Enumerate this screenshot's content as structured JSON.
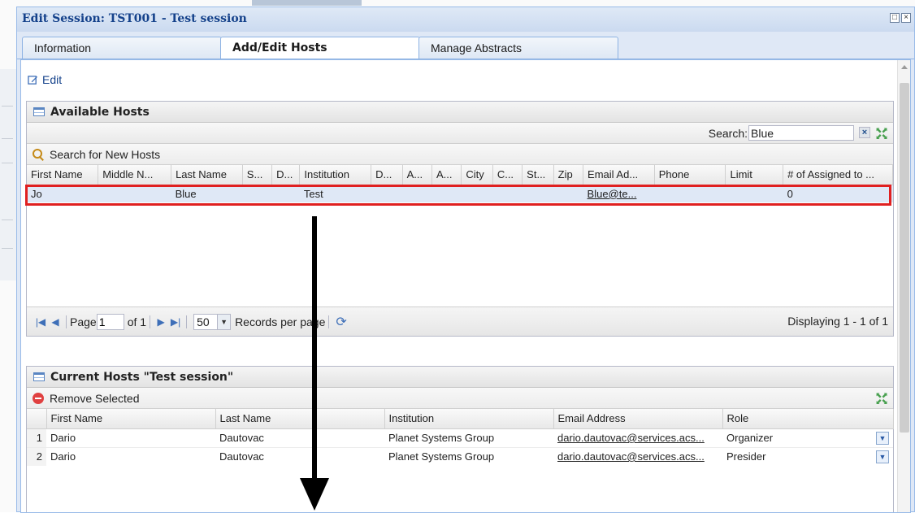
{
  "window": {
    "title": "Edit Session: TST001 - Test session"
  },
  "tabs": [
    {
      "label": "Information"
    },
    {
      "label": "Add/Edit Hosts"
    },
    {
      "label": "Manage Abstracts"
    }
  ],
  "edit_link": "Edit",
  "available_hosts": {
    "title": "Available Hosts",
    "search_label": "Search:",
    "search_value": "Blue",
    "action_label": "Search for New Hosts",
    "columns": [
      "First Name",
      "Middle N...",
      "Last Name",
      "S...",
      "D...",
      "Institution",
      "D...",
      "A...",
      "A...",
      "City",
      "C...",
      "St...",
      "Zip",
      "Email Ad...",
      "Phone",
      "Limit",
      "# of Assigned to ..."
    ],
    "rows": [
      [
        "Jo",
        "",
        "Blue",
        "",
        "",
        "Test",
        "",
        "",
        "",
        "",
        "",
        "",
        "",
        "Blue@te...",
        "",
        "",
        "0"
      ]
    ],
    "pager": {
      "page_label": "Page",
      "page_value": "1",
      "of_label": "of 1",
      "page_size": "50",
      "records_label": "Records per page",
      "displaying": "Displaying 1 - 1 of 1"
    }
  },
  "current_hosts": {
    "title": "Current Hosts \"Test session\"",
    "action_label": "Remove Selected",
    "columns": [
      "",
      "First Name",
      "Last Name",
      "Institution",
      "Email Address",
      "Role"
    ],
    "rows": [
      [
        "1",
        "Dario",
        "Dautovac",
        "Planet Systems Group",
        "dario.dautovac@services.acs...",
        "Organizer"
      ],
      [
        "2",
        "Dario",
        "Dautovac",
        "Planet Systems Group",
        "dario.dautovac@services.acs...",
        "Presider"
      ]
    ]
  },
  "colors": {
    "highlight": "#e02020",
    "header_text": "#15428b",
    "selected_row": "#dfe8f6"
  }
}
